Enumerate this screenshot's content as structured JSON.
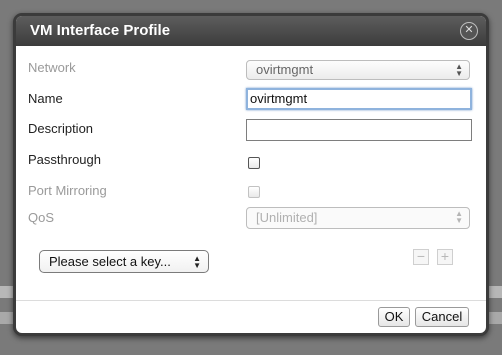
{
  "dialog": {
    "title": "VM Interface Profile",
    "close_icon": "close-icon"
  },
  "form": {
    "network_label": "Network",
    "network_value": "ovirtmgmt",
    "name_label": "Name",
    "name_value": "ovirtmgmt",
    "description_label": "Description",
    "description_value": "",
    "passthrough_label": "Passthrough",
    "passthrough_checked": false,
    "port_mirroring_label": "Port Mirroring",
    "port_mirroring_checked": false,
    "qos_label": "QoS",
    "qos_value": "[Unlimited]"
  },
  "custom_properties": {
    "key_select_value": "Please select a key...",
    "remove_symbol": "−",
    "add_symbol": "+"
  },
  "buttons": {
    "ok_label": "OK",
    "cancel_label": "Cancel"
  }
}
